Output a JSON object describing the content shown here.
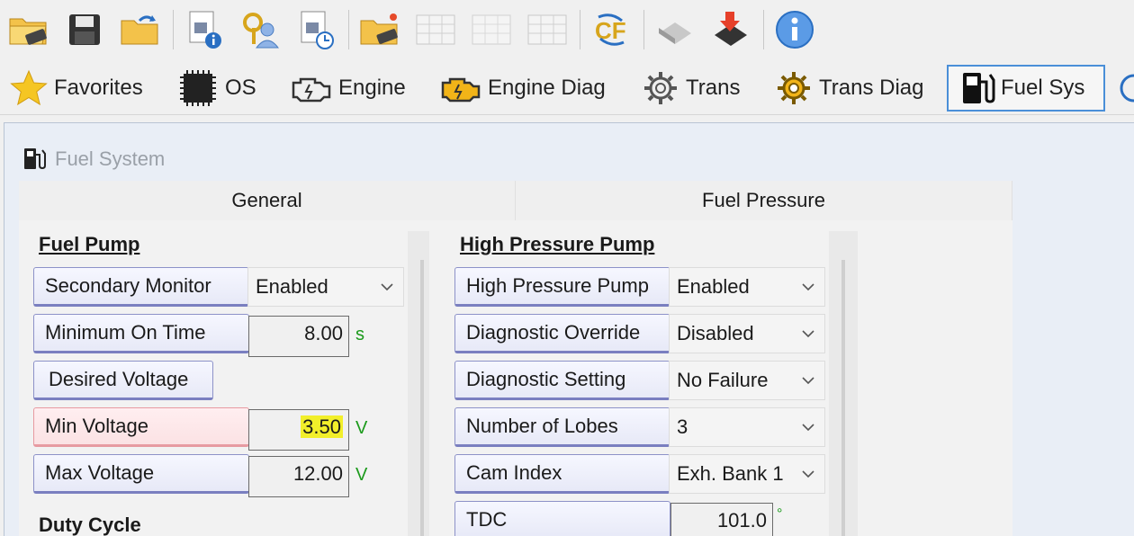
{
  "toolbar": {
    "icons": [
      "open-folder-icon",
      "save-icon",
      "folder-undo-icon",
      "document-info-icon",
      "user-key-icon",
      "document-clock-icon",
      "folder-new-icon",
      "table-icon",
      "table-disabled-icon",
      "table-disabled-2-icon",
      "refresh-cf-icon",
      "chip-eraser-icon",
      "chip-write-icon",
      "info-icon"
    ]
  },
  "nav": {
    "favorites": "Favorites",
    "os": "OS",
    "engine": "Engine",
    "engine_diag": "Engine Diag",
    "trans": "Trans",
    "trans_diag": "Trans Diag",
    "fuel_sys": "Fuel Sys"
  },
  "window": {
    "title": "Fuel System"
  },
  "tabs": {
    "general": "General",
    "fuel_pressure": "Fuel Pressure"
  },
  "fuel_pump": {
    "title": "Fuel Pump",
    "secondary_monitor": {
      "label": "Secondary Monitor",
      "value": "Enabled"
    },
    "minimum_on_time": {
      "label": "Minimum On Time",
      "value": "8.00",
      "unit": "s"
    },
    "desired_voltage": {
      "label": "Desired Voltage"
    },
    "min_voltage": {
      "label": "Min Voltage",
      "value": "3.50",
      "unit": "V"
    },
    "max_voltage": {
      "label": "Max Voltage",
      "value": "12.00",
      "unit": "V"
    },
    "duty_cycle_title": "Duty Cycle"
  },
  "high_pressure_pump": {
    "title": "High Pressure Pump",
    "high_pressure_pump": {
      "label": "High Pressure Pump",
      "value": "Enabled"
    },
    "diagnostic_override": {
      "label": "Diagnostic Override",
      "value": "Disabled"
    },
    "diagnostic_setting": {
      "label": "Diagnostic Setting",
      "value": "No Failure"
    },
    "number_of_lobes": {
      "label": "Number of Lobes",
      "value": "3"
    },
    "cam_index": {
      "label": "Cam Index",
      "value": "Exh. Bank 1"
    },
    "tdc": {
      "label": "TDC",
      "value": "101.0",
      "unit": "°"
    }
  },
  "colors": {
    "accent_border": "#4a8fd8",
    "label_border": "#7a7fc0",
    "error_border": "#e79aa1",
    "unit_green": "#1c9a1c",
    "highlight_yellow": "#f2ef2a"
  }
}
